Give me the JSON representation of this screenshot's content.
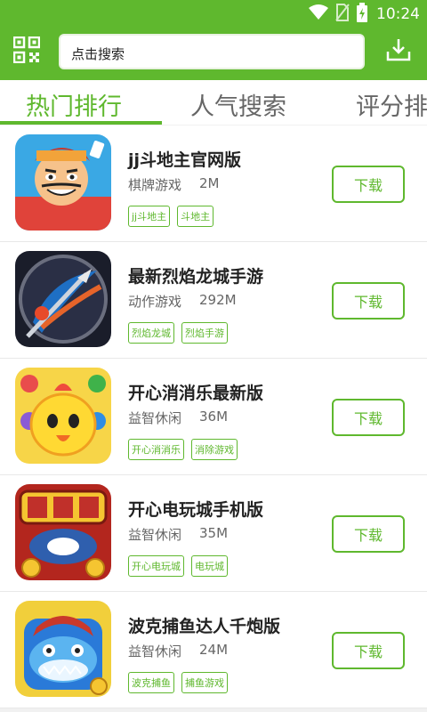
{
  "status_bar": {
    "time": "10:24"
  },
  "search": {
    "placeholder": "点击搜索"
  },
  "tabs": [
    {
      "label": "热门排行"
    },
    {
      "label": "人气搜索"
    },
    {
      "label": "评分排"
    }
  ],
  "apps": [
    {
      "name": "jj斗地主官网版",
      "category": "棋牌游戏",
      "size": "2M",
      "tags": [
        "jj斗地主",
        "斗地主"
      ],
      "download_label": "下载",
      "icon": "poker-character-icon"
    },
    {
      "name": "最新烈焰龙城手游",
      "category": "动作游戏",
      "size": "292M",
      "tags": [
        "烈焰龙城",
        "烈焰手游"
      ],
      "download_label": "下载",
      "icon": "sword-dragon-icon"
    },
    {
      "name": "开心消消乐最新版",
      "category": "益智休闲",
      "size": "36M",
      "tags": [
        "开心消消乐",
        "消除游戏"
      ],
      "download_label": "下载",
      "icon": "yellow-chick-icon"
    },
    {
      "name": "开心电玩城手机版",
      "category": "益智休闲",
      "size": "35M",
      "tags": [
        "开心电玩城",
        "电玩城"
      ],
      "download_label": "下载",
      "icon": "arcade-coin-icon"
    },
    {
      "name": "波克捕鱼达人千炮版",
      "category": "益智休闲",
      "size": "24M",
      "tags": [
        "波克捕鱼",
        "捕鱼游戏"
      ],
      "download_label": "下载",
      "icon": "shark-fish-icon"
    }
  ],
  "colors": {
    "accent": "#5fb82e",
    "background": "#f1f1f1"
  }
}
